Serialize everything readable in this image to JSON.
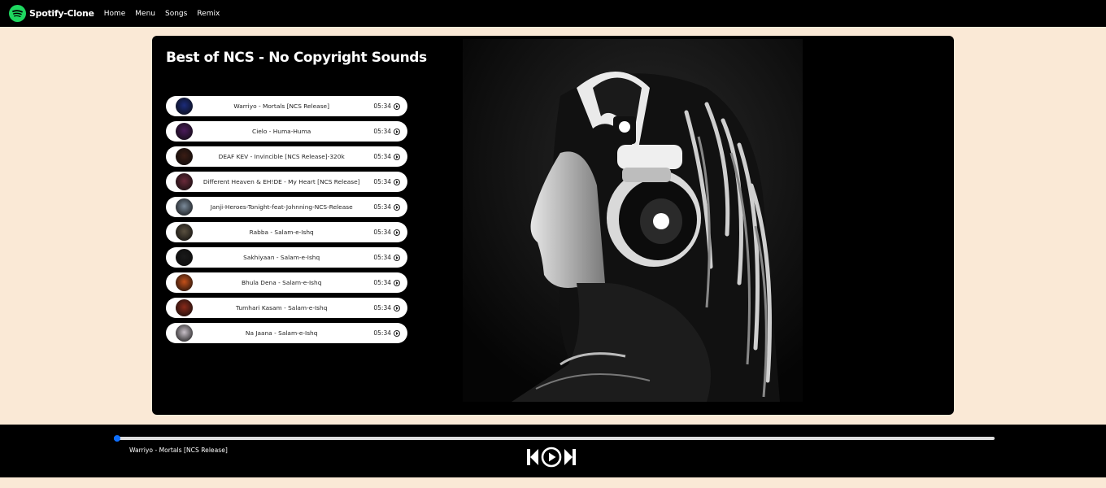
{
  "nav": {
    "brand": "Spotify-Clone",
    "links": [
      "Home",
      "Menu",
      "Songs",
      "Remix"
    ]
  },
  "playlist": {
    "title": "Best of NCS - No Copyright Sounds",
    "songs": [
      {
        "name": "Warriyo - Mortals [NCS Release]",
        "duration": "05:34",
        "thumb_color": "#1b2b7a"
      },
      {
        "name": "Cielo - Huma-Huma",
        "duration": "05:34",
        "thumb_color": "#4a1a5a"
      },
      {
        "name": "DEAF KEV - Invincible [NCS Release]-320k",
        "duration": "05:34",
        "thumb_color": "#3a1c14"
      },
      {
        "name": "Different Heaven & EH!DE - My Heart [NCS Release]",
        "duration": "05:34",
        "thumb_color": "#6a2a3a"
      },
      {
        "name": "Janji-Heroes-Tonight-feat-Johnning-NCS-Release",
        "duration": "05:34",
        "thumb_color": "#7a8a9a"
      },
      {
        "name": "Rabba - Salam-e-Ishq",
        "duration": "05:34",
        "thumb_color": "#5a5040"
      },
      {
        "name": "Sakhiyaan - Salam-e-Ishq",
        "duration": "05:34",
        "thumb_color": "#1a1a1a"
      },
      {
        "name": "Bhula Dena - Salam-e-Ishq",
        "duration": "05:34",
        "thumb_color": "#c4501a"
      },
      {
        "name": "Tumhari Kasam - Salam-e-Ishq",
        "duration": "05:34",
        "thumb_color": "#8a2a1a"
      },
      {
        "name": "Na Jaana - Salam-e-Ishq",
        "duration": "05:34",
        "thumb_color": "#c8c0c8"
      }
    ]
  },
  "player": {
    "now_playing": "Warriyo - Mortals [NCS Release]",
    "progress": 0.003,
    "accent_color": "#0d6efd"
  },
  "icons": {
    "brand": "spotify-logo-icon",
    "song_play": "play-circle-icon",
    "prev": "skip-back-icon",
    "play": "play-circle-icon",
    "next": "skip-forward-icon"
  }
}
